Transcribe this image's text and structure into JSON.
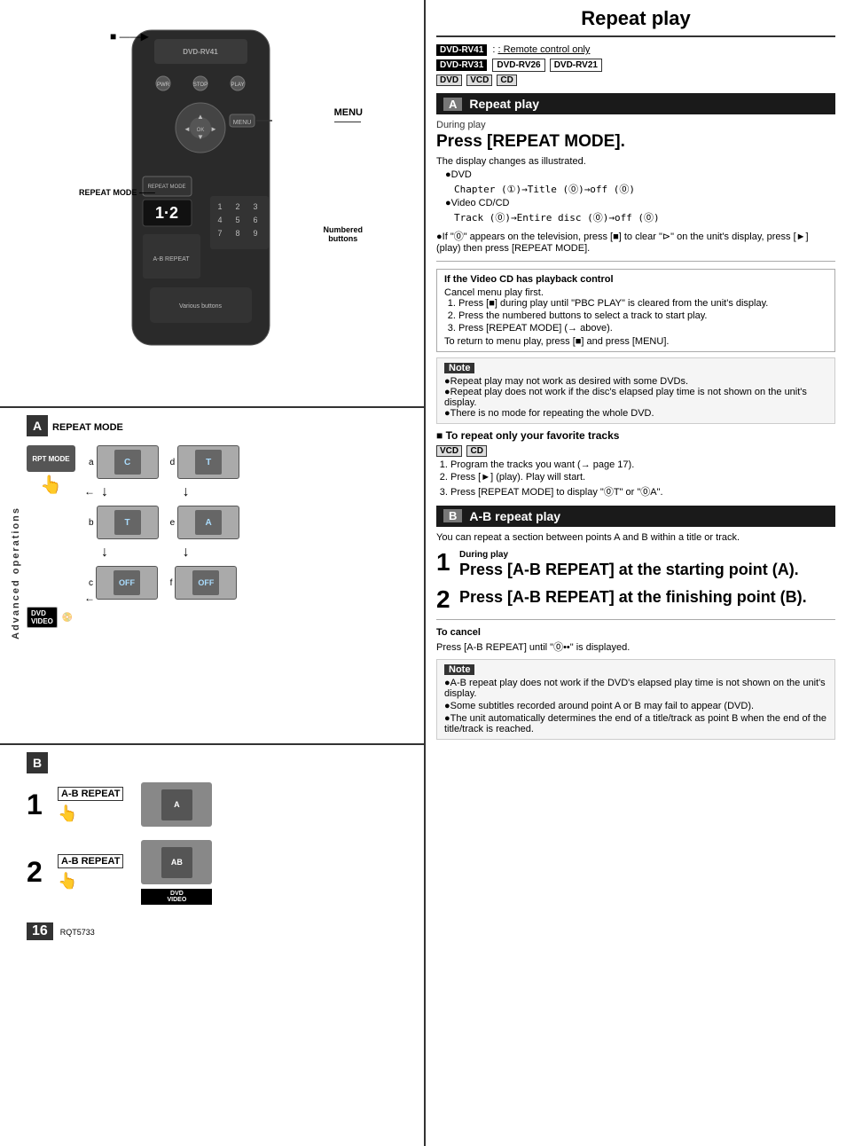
{
  "page": {
    "number": "16",
    "code": "RQT5733"
  },
  "right_panel": {
    "title": "Repeat play",
    "models": {
      "line1_tag": "DVD-RV41",
      "line1_suffix": ": Remote control only",
      "line2_tags": [
        "DVD-RV31",
        "DVD-RV26",
        "DVD-RV21"
      ],
      "line3_tags": [
        "DVD",
        "VCD",
        "CD"
      ]
    },
    "section_a": {
      "letter": "A",
      "heading": "Repeat play",
      "during_play": "During play",
      "big_instruction": "Press [REPEAT MODE].",
      "sub": "The display changes as illustrated.",
      "dvd_label": "●DVD",
      "dvd_flow": "Chapter (①)→Title (⓪)→off (⓪)",
      "vcd_label": "●Video CD/CD",
      "vcd_flow": "Track (⓪)→Entire disc (⓪)→off (⓪)",
      "note1": "●If \"⓪\" appears on the television, press [■] to clear \"⊳\" on the unit's display, press [►] (play) then press [REPEAT MODE].",
      "info_box": {
        "title": "If the Video CD has playback control",
        "line0": "Cancel menu play first.",
        "items": [
          "Press [■] during play until \"PBC PLAY\" is cleared from the unit's display.",
          "Press the numbered buttons to select a track to start play.",
          "Press [REPEAT MODE] (→ above)."
        ],
        "footer": "To return to menu play, press [■] and press [MENU]."
      },
      "note_box": {
        "title": "Note",
        "items": [
          "●Repeat play may not work as desired with some DVDs.",
          "●Repeat play does not work if the disc's elapsed play time is not shown on the unit's display.",
          "●There is no mode for repeating the whole DVD."
        ]
      },
      "fav_tracks": {
        "heading": "■ To repeat only your favorite tracks",
        "tags": [
          "VCD",
          "CD"
        ],
        "items": [
          "Program the tracks you want (→ page 17).",
          "Press [►] (play). Play will start.",
          "Press [REPEAT MODE] to display \"⓪T\" or \"⓪A\"."
        ]
      }
    },
    "section_b": {
      "letter": "B",
      "heading": "A-B repeat play",
      "intro": "You can repeat a section between points A and B within a title or track.",
      "step1": {
        "num": "1",
        "during": "During play",
        "text": "Press [A-B REPEAT] at the starting point (A)."
      },
      "step2": {
        "num": "2",
        "text": "Press [A-B REPEAT] at the finishing point (B)."
      },
      "to_cancel_label": "To cancel",
      "to_cancel_text": "Press [A-B REPEAT] until \"⓪••\" is displayed.",
      "note_box": {
        "title": "Note",
        "items": [
          "●A-B repeat play does not work if the DVD's elapsed play time is not shown on the unit's display.",
          "●Some subtitles recorded around point A or B may fail to appear (DVD).",
          "●The unit automatically determines the end of a title/track as point B when the end of the title/track is reached."
        ]
      }
    }
  },
  "left_panel": {
    "side_label": "Advanced operations",
    "section_a_label": "A",
    "section_b_label": "B",
    "repeat_mode_label": "REPEAT MODE",
    "numbered_buttons_label": "Numbered\nbuttons",
    "menu_label": "MENU",
    "number_display": "1·2",
    "ab_repeat_label": "A-B REPEAT",
    "diagram_labels": {
      "a_items": [
        "C",
        "T",
        "OFF",
        "T",
        "A",
        "OFF"
      ]
    }
  }
}
